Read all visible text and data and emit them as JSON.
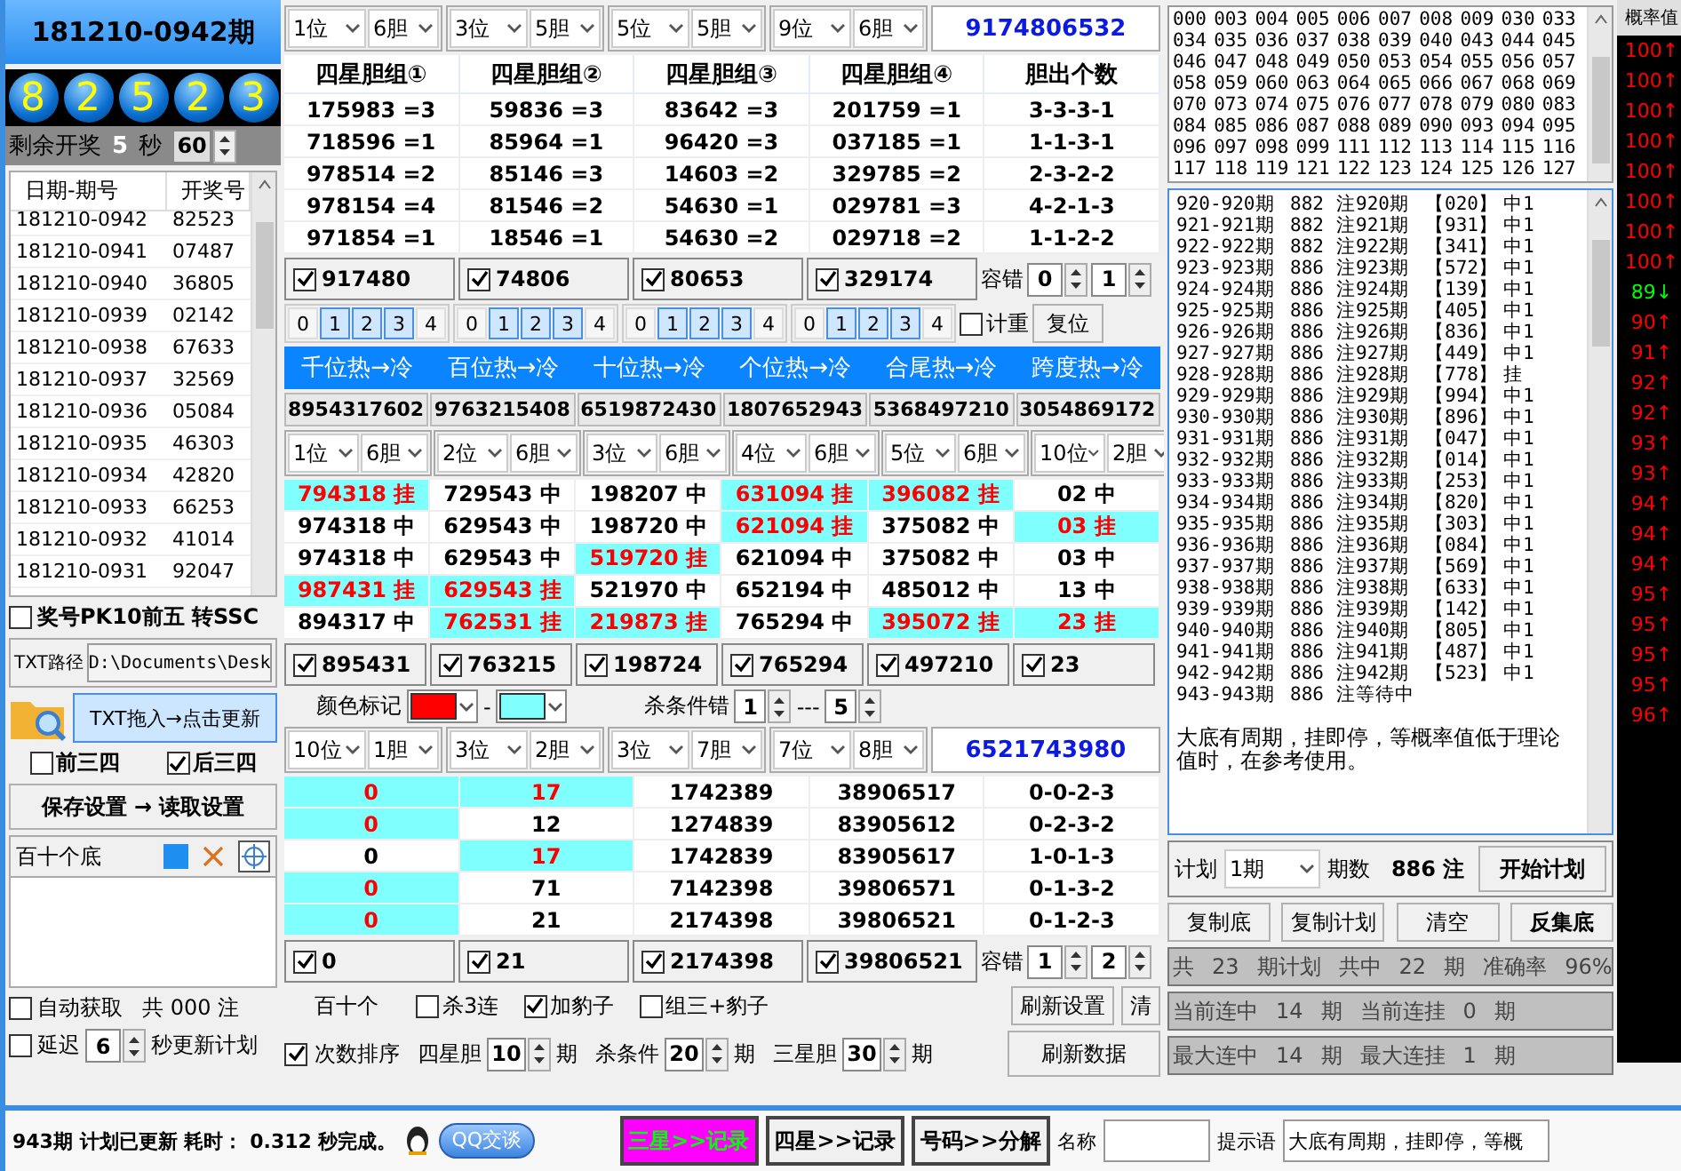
{
  "left": {
    "title": "181210-0942期",
    "balls": [
      "8",
      "2",
      "5",
      "2",
      "3"
    ],
    "countdown": {
      "label": "剩余开奖",
      "value": "5",
      "unit": "秒",
      "seconds": "60"
    },
    "history": {
      "columns": [
        "日期-期号",
        "开奖号"
      ],
      "rows": [
        [
          "181210-0942",
          "82523"
        ],
        [
          "181210-0941",
          "07487"
        ],
        [
          "181210-0940",
          "36805"
        ],
        [
          "181210-0939",
          "02142"
        ],
        [
          "181210-0938",
          "67633"
        ],
        [
          "181210-0937",
          "32569"
        ],
        [
          "181210-0936",
          "05084"
        ],
        [
          "181210-0935",
          "46303"
        ],
        [
          "181210-0934",
          "42820"
        ],
        [
          "181210-0933",
          "66253"
        ],
        [
          "181210-0932",
          "41014"
        ],
        [
          "181210-0931",
          "92047"
        ]
      ]
    },
    "pk10": {
      "label": "奖号PK10前五  转SSC",
      "checked": false
    },
    "txt_path": {
      "label": "TXT路径",
      "value": "D:\\Documents\\Desk"
    },
    "drag_button": "TXT拖入→点击更新",
    "options": [
      {
        "label": "前三四",
        "checked": false
      },
      {
        "label": "后三四",
        "checked": true
      }
    ],
    "save_load": "保存设置 → 读取设置",
    "base_panel": {
      "title": "百十个底"
    },
    "auto": {
      "label": "自动获取",
      "checked": false,
      "count": "共 000 注"
    },
    "delay": {
      "label": "延迟",
      "checked": false,
      "value": "6",
      "suffix": "秒更新计划"
    }
  },
  "middle": {
    "group1": {
      "selects": [
        [
          "1位",
          "6胆"
        ],
        [
          "3位",
          "5胆"
        ],
        [
          "5位",
          "5胆"
        ],
        [
          "9位",
          "6胆"
        ]
      ],
      "result": "9174806532"
    },
    "table1": {
      "columns": [
        "四星胆组①",
        "四星胆组②",
        "四星胆组③",
        "四星胆组④",
        "胆出个数"
      ],
      "rows": [
        [
          "175983 =3",
          "59836 =3",
          "83642 =3",
          "201759 =1",
          "3-3-3-1"
        ],
        [
          "718596 =1",
          "85964 =1",
          "96420 =3",
          "037185 =1",
          "1-1-3-1"
        ],
        [
          "978514 =2",
          "85146 =3",
          "14603 =2",
          "329785 =2",
          "2-3-2-2"
        ],
        [
          "978154 =4",
          "81546 =2",
          "54630 =1",
          "029781 =3",
          "4-2-1-3"
        ],
        [
          "971854 =1",
          "18546 =1",
          "54630 =2",
          "029718 =2",
          "1-1-2-2"
        ]
      ]
    },
    "checks1": [
      {
        "value": "917480",
        "checked": true
      },
      {
        "value": "74806",
        "checked": true
      },
      {
        "value": "80653",
        "checked": true
      },
      {
        "value": "329174",
        "checked": true
      }
    ],
    "tolerance1": {
      "label": "容错",
      "values": [
        "0",
        "1"
      ]
    },
    "digit_pickers": [
      {
        "digits": [
          {
            "label": "0",
            "selected": false
          },
          {
            "label": "1",
            "selected": true
          },
          {
            "label": "2",
            "selected": true
          },
          {
            "label": "3",
            "selected": true
          },
          {
            "label": "4",
            "selected": false
          }
        ]
      },
      {
        "digits": [
          {
            "label": "0",
            "selected": false
          },
          {
            "label": "1",
            "selected": true
          },
          {
            "label": "2",
            "selected": true
          },
          {
            "label": "3",
            "selected": true
          },
          {
            "label": "4",
            "selected": false
          }
        ]
      },
      {
        "digits": [
          {
            "label": "0",
            "selected": false
          },
          {
            "label": "1",
            "selected": true
          },
          {
            "label": "2",
            "selected": true
          },
          {
            "label": "3",
            "selected": true
          },
          {
            "label": "4",
            "selected": false
          }
        ]
      },
      {
        "digits": [
          {
            "label": "0",
            "selected": false
          },
          {
            "label": "1",
            "selected": true
          },
          {
            "label": "2",
            "selected": true
          },
          {
            "label": "3",
            "selected": true
          },
          {
            "label": "4",
            "selected": false
          }
        ]
      }
    ],
    "weight": {
      "label": "计重",
      "checked": false
    },
    "reset": "复位",
    "hot": {
      "columns": [
        "千位热→冷",
        "百位热→冷",
        "十位热→冷",
        "个位热→冷",
        "合尾热→冷",
        "跨度热→冷"
      ],
      "values": [
        "8954317602",
        "9763215408",
        "6519872430",
        "1807652943",
        "5368497210",
        "3054869172"
      ],
      "selects": [
        [
          "1位",
          "6胆"
        ],
        [
          "2位",
          "6胆"
        ],
        [
          "3位",
          "6胆"
        ],
        [
          "4位",
          "6胆"
        ],
        [
          "5位",
          "6胆"
        ],
        [
          "10位",
          "2胆"
        ]
      ],
      "rows": [
        [
          {
            "text": "794318 挂",
            "miss": true
          },
          {
            "text": "729543 中",
            "miss": false
          },
          {
            "text": "198207 中",
            "miss": false
          },
          {
            "text": "631094 挂",
            "miss": true
          },
          {
            "text": "396082 挂",
            "miss": true
          },
          {
            "text": "02 中",
            "miss": false
          }
        ],
        [
          {
            "text": "974318 中",
            "miss": false
          },
          {
            "text": "629543 中",
            "miss": false
          },
          {
            "text": "198720 中",
            "miss": false
          },
          {
            "text": "621094 挂",
            "miss": true
          },
          {
            "text": "375082 中",
            "miss": false
          },
          {
            "text": "03 挂",
            "miss": true
          }
        ],
        [
          {
            "text": "974318 中",
            "miss": false
          },
          {
            "text": "629543 中",
            "miss": false
          },
          {
            "text": "519720 挂",
            "miss": true
          },
          {
            "text": "621094 中",
            "miss": false
          },
          {
            "text": "375082 中",
            "miss": false
          },
          {
            "text": "03 中",
            "miss": false
          }
        ],
        [
          {
            "text": "987431 挂",
            "miss": true
          },
          {
            "text": "629543 挂",
            "miss": true
          },
          {
            "text": "521970 中",
            "miss": false
          },
          {
            "text": "652194 中",
            "miss": false
          },
          {
            "text": "485012 中",
            "miss": false
          },
          {
            "text": "13 中",
            "miss": false
          }
        ],
        [
          {
            "text": "894317 中",
            "miss": false
          },
          {
            "text": "762531 挂",
            "miss": true
          },
          {
            "text": "219873 挂",
            "miss": true
          },
          {
            "text": "765294 中",
            "miss": false
          },
          {
            "text": "395072 挂",
            "miss": true
          },
          {
            "text": "23 挂",
            "miss": true
          }
        ]
      ]
    },
    "checks2": [
      {
        "value": "895431",
        "checked": true
      },
      {
        "value": "763215",
        "checked": true
      },
      {
        "value": "198724",
        "checked": true
      },
      {
        "value": "765294",
        "checked": true
      },
      {
        "value": "497210",
        "checked": true
      },
      {
        "value": "23",
        "checked": true
      }
    ],
    "color_mark": {
      "label": "颜色标记",
      "colors": [
        {
          "color": "#ff0000"
        },
        {
          "color": "#80ffff"
        }
      ],
      "separator": "-"
    },
    "kill": {
      "label": "杀条件错",
      "from": "1",
      "dash": "---",
      "to": "5"
    },
    "group3": {
      "selects": [
        [
          "10位",
          "1胆"
        ],
        [
          "3位",
          "2胆"
        ],
        [
          "3位",
          "7胆"
        ],
        [
          "7位",
          "8胆"
        ]
      ],
      "result": "6521743980"
    },
    "table3": {
      "rows": [
        [
          {
            "text": "0",
            "miss": true
          },
          {
            "text": "17",
            "miss": true
          },
          {
            "text": "1742389",
            "miss": false
          },
          {
            "text": "38906517",
            "miss": false
          },
          {
            "text": "0-0-2-3",
            "miss": false
          }
        ],
        [
          {
            "text": "0",
            "miss": true
          },
          {
            "text": "12",
            "miss": false
          },
          {
            "text": "1274839",
            "miss": false
          },
          {
            "text": "83905612",
            "miss": false
          },
          {
            "text": "0-2-3-2",
            "miss": false
          }
        ],
        [
          {
            "text": "0",
            "miss": false
          },
          {
            "text": "17",
            "miss": true
          },
          {
            "text": "1742839",
            "miss": false
          },
          {
            "text": "83905617",
            "miss": false
          },
          {
            "text": "1-0-1-3",
            "miss": false
          }
        ],
        [
          {
            "text": "0",
            "miss": true
          },
          {
            "text": "71",
            "miss": false
          },
          {
            "text": "7142398",
            "miss": false
          },
          {
            "text": "39806571",
            "miss": false
          },
          {
            "text": "0-1-3-2",
            "miss": false
          }
        ],
        [
          {
            "text": "0",
            "miss": true
          },
          {
            "text": "21",
            "miss": false
          },
          {
            "text": "2174398",
            "miss": false
          },
          {
            "text": "39806521",
            "miss": false
          },
          {
            "text": "0-1-2-3",
            "miss": false
          }
        ]
      ]
    },
    "checks3": [
      {
        "value": "0",
        "checked": true
      },
      {
        "value": "21",
        "checked": true
      },
      {
        "value": "2174398",
        "checked": true
      },
      {
        "value": "39806521",
        "checked": true
      }
    ],
    "tolerance3": {
      "label": "容错",
      "values": [
        "1",
        "2"
      ]
    },
    "options_row": {
      "label": "百十个",
      "options": [
        {
          "label": "杀3连",
          "checked": false
        },
        {
          "label": "加豹子",
          "checked": true
        },
        {
          "label": "组三+豹子",
          "checked": false
        }
      ],
      "buttons": [
        "刷新设置",
        "清"
      ]
    },
    "params_row": {
      "sort": {
        "label": "次数排序",
        "checked": true
      },
      "params": [
        {
          "label": "四星胆",
          "value": "10",
          "unit": "期"
        },
        {
          "label": "杀条件",
          "value": "20",
          "unit": "期"
        },
        {
          "label": "三星胆",
          "value": "30",
          "unit": "期"
        }
      ],
      "button": "刷新数据"
    }
  },
  "right": {
    "numbers": [
      "000",
      "003",
      "004",
      "005",
      "006",
      "007",
      "008",
      "009",
      "030",
      "033",
      "034",
      "035",
      "036",
      "037",
      "038",
      "039",
      "040",
      "043",
      "044",
      "045",
      "046",
      "047",
      "048",
      "049",
      "050",
      "053",
      "054",
      "055",
      "056",
      "057",
      "058",
      "059",
      "060",
      "063",
      "064",
      "065",
      "066",
      "067",
      "068",
      "069",
      "070",
      "073",
      "074",
      "075",
      "076",
      "077",
      "078",
      "079",
      "080",
      "083",
      "084",
      "085",
      "086",
      "087",
      "088",
      "089",
      "090",
      "093",
      "094",
      "095",
      "096",
      "097",
      "098",
      "099",
      "111",
      "112",
      "113",
      "114",
      "115",
      "116",
      "117",
      "118",
      "119",
      "121",
      "122",
      "123",
      "124",
      "125",
      "126",
      "127"
    ],
    "log": [
      [
        "920-920期",
        "882",
        "注920期",
        "【020】",
        "中1"
      ],
      [
        "921-921期",
        "882",
        "注921期",
        "【931】",
        "中1"
      ],
      [
        "922-922期",
        "882",
        "注922期",
        "【341】",
        "中1"
      ],
      [
        "923-923期",
        "886",
        "注923期",
        "【572】",
        "中1"
      ],
      [
        "924-924期",
        "886",
        "注924期",
        "【139】",
        "中1"
      ],
      [
        "925-925期",
        "886",
        "注925期",
        "【405】",
        "中1"
      ],
      [
        "926-926期",
        "886",
        "注926期",
        "【836】",
        "中1"
      ],
      [
        "927-927期",
        "886",
        "注927期",
        "【449】",
        "中1"
      ],
      [
        "928-928期",
        "886",
        "注928期",
        "【778】",
        "挂"
      ],
      [
        "929-929期",
        "886",
        "注929期",
        "【994】",
        "中1"
      ],
      [
        "930-930期",
        "886",
        "注930期",
        "【896】",
        "中1"
      ],
      [
        "931-931期",
        "886",
        "注931期",
        "【047】",
        "中1"
      ],
      [
        "932-932期",
        "886",
        "注932期",
        "【014】",
        "中1"
      ],
      [
        "933-933期",
        "886",
        "注933期",
        "【253】",
        "中1"
      ],
      [
        "934-934期",
        "886",
        "注934期",
        "【820】",
        "中1"
      ],
      [
        "935-935期",
        "886",
        "注935期",
        "【303】",
        "中1"
      ],
      [
        "936-936期",
        "886",
        "注936期",
        "【084】",
        "中1"
      ],
      [
        "937-937期",
        "886",
        "注937期",
        "【569】",
        "中1"
      ],
      [
        "938-938期",
        "886",
        "注938期",
        "【633】",
        "中1"
      ],
      [
        "939-939期",
        "886",
        "注939期",
        "【142】",
        "中1"
      ],
      [
        "940-940期",
        "886",
        "注940期",
        "【805】",
        "中1"
      ],
      [
        "941-941期",
        "886",
        "注941期",
        "【487】",
        "中1"
      ],
      [
        "942-942期",
        "886",
        "注942期",
        "【523】",
        "中1"
      ],
      [
        "943-943期",
        "886",
        "注等待中"
      ]
    ],
    "note": "大底有周期，挂即停，等概率值低于理论值时，在参考使用。",
    "plan": {
      "label": "计划",
      "select": "1期",
      "count_label": "期数",
      "count": "886",
      "unit": "注",
      "button": "开始计划"
    },
    "buttons": [
      "复制底",
      "复制计划",
      "清空",
      "反集底"
    ],
    "stats": [
      [
        "共",
        "23",
        "期计划",
        "共中",
        "22",
        "期",
        "准确率",
        "96%"
      ],
      [
        "当前连中",
        "14",
        "期",
        "当前连挂",
        "0",
        "期"
      ],
      [
        "最大连中",
        "14",
        "期",
        "最大连挂",
        "1",
        "期"
      ]
    ]
  },
  "probability": {
    "header": "概率值",
    "values": [
      {
        "text": "100↑",
        "color": "#ff0000"
      },
      {
        "text": "100↑",
        "color": "#ff0000"
      },
      {
        "text": "100↑",
        "color": "#ff0000"
      },
      {
        "text": "100↑",
        "color": "#ff0000"
      },
      {
        "text": "100↑",
        "color": "#ff0000"
      },
      {
        "text": "100↑",
        "color": "#ff0000"
      },
      {
        "text": "100↑",
        "color": "#ff0000"
      },
      {
        "text": "100↑",
        "color": "#ff0000"
      },
      {
        "text": "89↓",
        "color": "#00ff00"
      },
      {
        "text": "90↑",
        "color": "#ff0000"
      },
      {
        "text": "91↑",
        "color": "#ff0000"
      },
      {
        "text": "92↑",
        "color": "#ff0000"
      },
      {
        "text": "92↑",
        "color": "#ff0000"
      },
      {
        "text": "93↑",
        "color": "#ff0000"
      },
      {
        "text": "93↑",
        "color": "#ff0000"
      },
      {
        "text": "94↑",
        "color": "#ff0000"
      },
      {
        "text": "94↑",
        "color": "#ff0000"
      },
      {
        "text": "94↑",
        "color": "#ff0000"
      },
      {
        "text": "95↑",
        "color": "#ff0000"
      },
      {
        "text": "95↑",
        "color": "#ff0000"
      },
      {
        "text": "95↑",
        "color": "#ff0000"
      },
      {
        "text": "95↑",
        "color": "#ff0000"
      },
      {
        "text": "96↑",
        "color": "#ff0000"
      }
    ]
  },
  "status_bar": {
    "message": "943期 计划已更新 耗时：",
    "time": "0.312 秒完成。",
    "qq_button": "QQ交谈",
    "buttons": [
      {
        "label": "三星>>记录",
        "highlighted": true
      },
      {
        "label": "四星>>记录",
        "highlighted": false
      },
      {
        "label": "号码>>分解",
        "highlighted": false
      }
    ],
    "name_label": "名称",
    "hint_label": "提示语",
    "hint_value": "大底有周期，挂即停，等概"
  }
}
